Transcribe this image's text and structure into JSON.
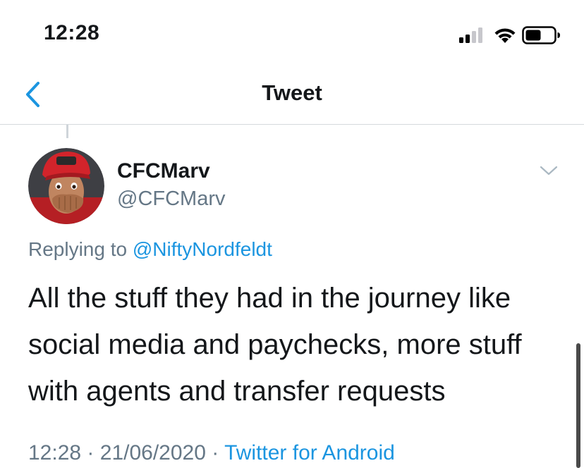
{
  "status_bar": {
    "time": "12:28",
    "icons": [
      "cellular-signal-icon",
      "wifi-icon",
      "battery-icon"
    ]
  },
  "nav": {
    "back_icon": "chevron-left-icon",
    "title": "Tweet"
  },
  "tweet": {
    "author": {
      "display_name": "CFCMarv",
      "handle": "@CFCMarv",
      "avatar_icon": "avatar"
    },
    "menu_icon": "chevron-down-icon",
    "replying_prefix": "Replying to",
    "replying_to": "@NiftyNordfeldt",
    "text": "All the stuff they had in the journey like social media and paychecks, more stuff with agents and transfer requests",
    "time": "12:28",
    "separator": "·",
    "date": "21/06/2020",
    "source": "Twitter for Android"
  },
  "colors": {
    "accent": "#1b95e0",
    "muted": "#657786",
    "text": "#14171a",
    "divider": "#d5d9dd"
  }
}
